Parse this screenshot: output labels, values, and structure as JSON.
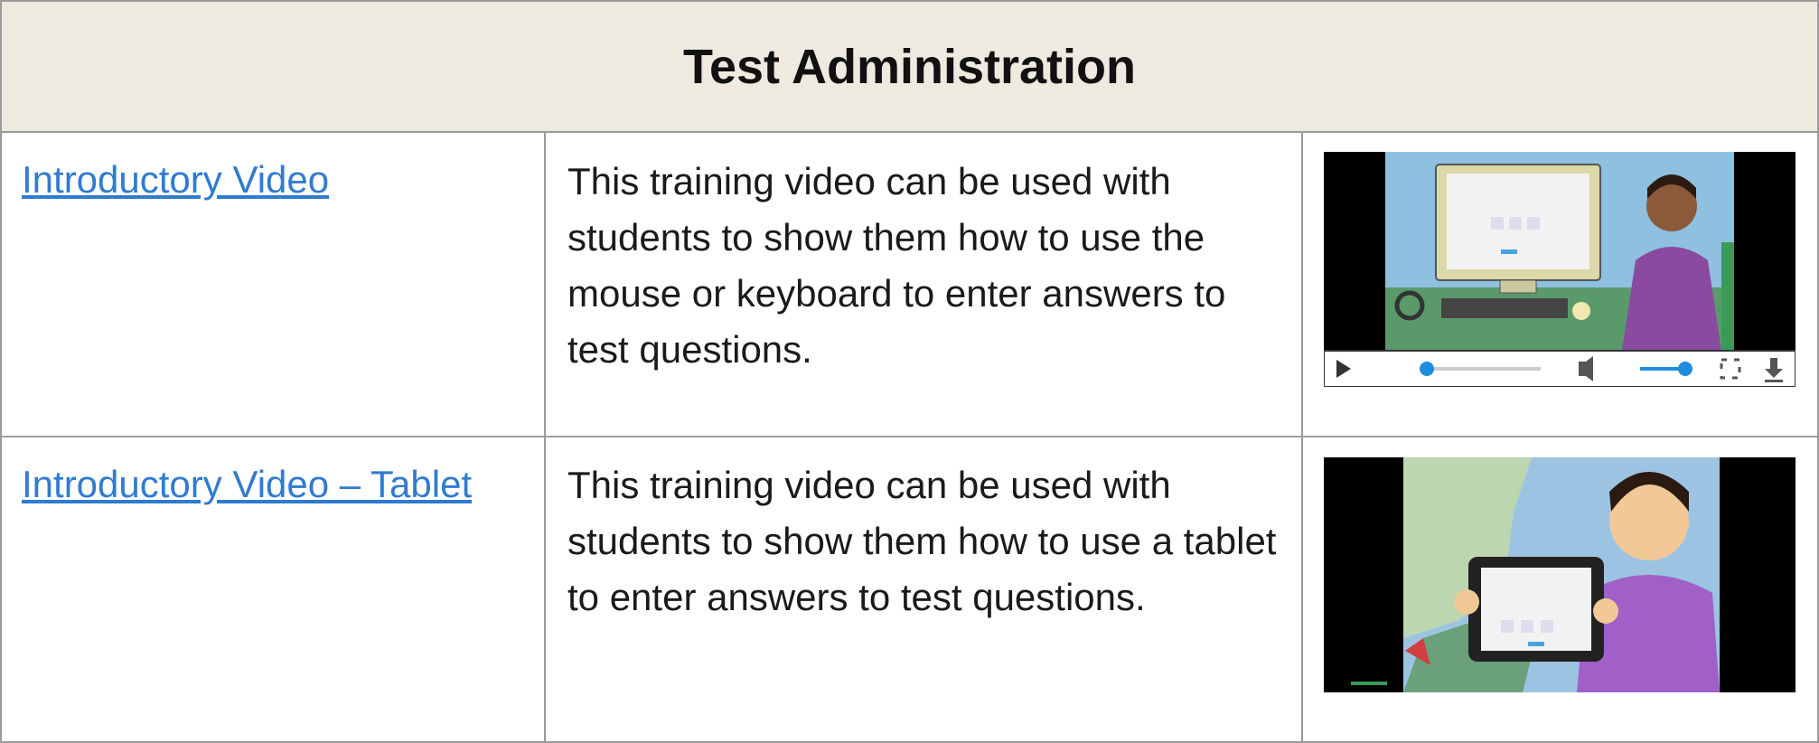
{
  "table": {
    "title": "Test Administration",
    "rows": [
      {
        "link": "Introductory Video",
        "description": "This training video can be used with students to show them how to use the mouse or keyboard to enter answers to test questions.",
        "thumbnail": "computer-video-thumbnail"
      },
      {
        "link": "Introductory Video – Tablet",
        "description": "This training video can be used with students to show them how to use a tablet to enter answers to test questions.",
        "thumbnail": "tablet-video-thumbnail"
      }
    ]
  },
  "colors": {
    "header_bg": "#eeeae0",
    "link": "#2f7bd1",
    "border": "#9a9a9a"
  }
}
